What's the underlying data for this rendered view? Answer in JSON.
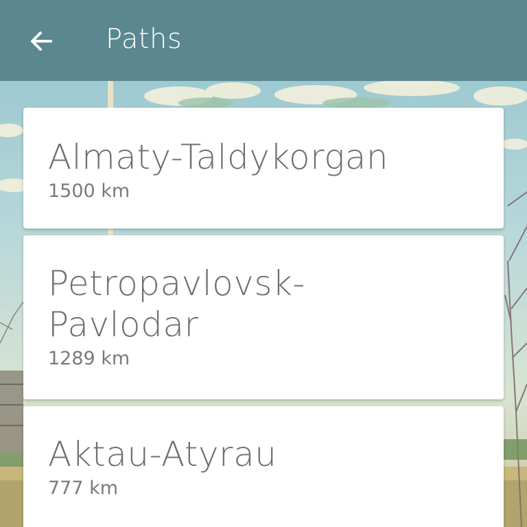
{
  "appbar": {
    "title": "Paths",
    "back_icon": "arrow-left-icon",
    "background_color": "#5b8790"
  },
  "paths": [
    {
      "name": "Almaty-Taldykorgan",
      "distance": "1500 km"
    },
    {
      "name": "Petropavlovsk-Pavlodar",
      "distance": "1289 km"
    },
    {
      "name": "Aktau-Atyrau",
      "distance": "777 km"
    }
  ]
}
